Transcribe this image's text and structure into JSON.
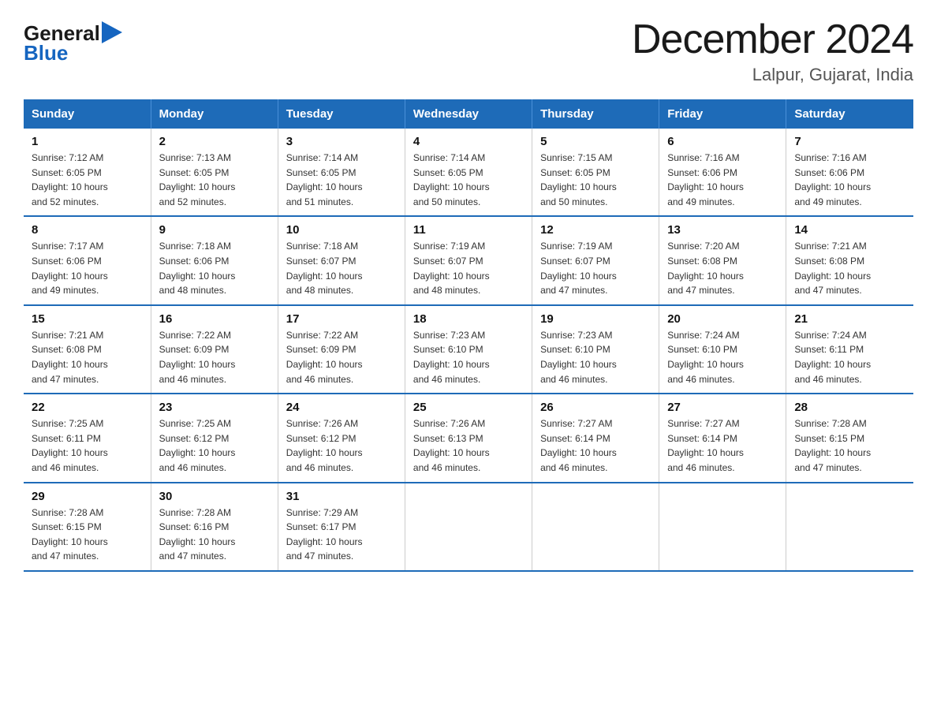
{
  "header": {
    "logo_line1": "General",
    "logo_line2": "Blue",
    "title": "December 2024",
    "subtitle": "Lalpur, Gujarat, India"
  },
  "days_of_week": [
    "Sunday",
    "Monday",
    "Tuesday",
    "Wednesday",
    "Thursday",
    "Friday",
    "Saturday"
  ],
  "weeks": [
    [
      {
        "date": "1",
        "sunrise": "7:12 AM",
        "sunset": "6:05 PM",
        "daylight": "10 hours and 52 minutes."
      },
      {
        "date": "2",
        "sunrise": "7:13 AM",
        "sunset": "6:05 PM",
        "daylight": "10 hours and 52 minutes."
      },
      {
        "date": "3",
        "sunrise": "7:14 AM",
        "sunset": "6:05 PM",
        "daylight": "10 hours and 51 minutes."
      },
      {
        "date": "4",
        "sunrise": "7:14 AM",
        "sunset": "6:05 PM",
        "daylight": "10 hours and 50 minutes."
      },
      {
        "date": "5",
        "sunrise": "7:15 AM",
        "sunset": "6:05 PM",
        "daylight": "10 hours and 50 minutes."
      },
      {
        "date": "6",
        "sunrise": "7:16 AM",
        "sunset": "6:06 PM",
        "daylight": "10 hours and 49 minutes."
      },
      {
        "date": "7",
        "sunrise": "7:16 AM",
        "sunset": "6:06 PM",
        "daylight": "10 hours and 49 minutes."
      }
    ],
    [
      {
        "date": "8",
        "sunrise": "7:17 AM",
        "sunset": "6:06 PM",
        "daylight": "10 hours and 49 minutes."
      },
      {
        "date": "9",
        "sunrise": "7:18 AM",
        "sunset": "6:06 PM",
        "daylight": "10 hours and 48 minutes."
      },
      {
        "date": "10",
        "sunrise": "7:18 AM",
        "sunset": "6:07 PM",
        "daylight": "10 hours and 48 minutes."
      },
      {
        "date": "11",
        "sunrise": "7:19 AM",
        "sunset": "6:07 PM",
        "daylight": "10 hours and 48 minutes."
      },
      {
        "date": "12",
        "sunrise": "7:19 AM",
        "sunset": "6:07 PM",
        "daylight": "10 hours and 47 minutes."
      },
      {
        "date": "13",
        "sunrise": "7:20 AM",
        "sunset": "6:08 PM",
        "daylight": "10 hours and 47 minutes."
      },
      {
        "date": "14",
        "sunrise": "7:21 AM",
        "sunset": "6:08 PM",
        "daylight": "10 hours and 47 minutes."
      }
    ],
    [
      {
        "date": "15",
        "sunrise": "7:21 AM",
        "sunset": "6:08 PM",
        "daylight": "10 hours and 47 minutes."
      },
      {
        "date": "16",
        "sunrise": "7:22 AM",
        "sunset": "6:09 PM",
        "daylight": "10 hours and 46 minutes."
      },
      {
        "date": "17",
        "sunrise": "7:22 AM",
        "sunset": "6:09 PM",
        "daylight": "10 hours and 46 minutes."
      },
      {
        "date": "18",
        "sunrise": "7:23 AM",
        "sunset": "6:10 PM",
        "daylight": "10 hours and 46 minutes."
      },
      {
        "date": "19",
        "sunrise": "7:23 AM",
        "sunset": "6:10 PM",
        "daylight": "10 hours and 46 minutes."
      },
      {
        "date": "20",
        "sunrise": "7:24 AM",
        "sunset": "6:10 PM",
        "daylight": "10 hours and 46 minutes."
      },
      {
        "date": "21",
        "sunrise": "7:24 AM",
        "sunset": "6:11 PM",
        "daylight": "10 hours and 46 minutes."
      }
    ],
    [
      {
        "date": "22",
        "sunrise": "7:25 AM",
        "sunset": "6:11 PM",
        "daylight": "10 hours and 46 minutes."
      },
      {
        "date": "23",
        "sunrise": "7:25 AM",
        "sunset": "6:12 PM",
        "daylight": "10 hours and 46 minutes."
      },
      {
        "date": "24",
        "sunrise": "7:26 AM",
        "sunset": "6:12 PM",
        "daylight": "10 hours and 46 minutes."
      },
      {
        "date": "25",
        "sunrise": "7:26 AM",
        "sunset": "6:13 PM",
        "daylight": "10 hours and 46 minutes."
      },
      {
        "date": "26",
        "sunrise": "7:27 AM",
        "sunset": "6:14 PM",
        "daylight": "10 hours and 46 minutes."
      },
      {
        "date": "27",
        "sunrise": "7:27 AM",
        "sunset": "6:14 PM",
        "daylight": "10 hours and 46 minutes."
      },
      {
        "date": "28",
        "sunrise": "7:28 AM",
        "sunset": "6:15 PM",
        "daylight": "10 hours and 47 minutes."
      }
    ],
    [
      {
        "date": "29",
        "sunrise": "7:28 AM",
        "sunset": "6:15 PM",
        "daylight": "10 hours and 47 minutes."
      },
      {
        "date": "30",
        "sunrise": "7:28 AM",
        "sunset": "6:16 PM",
        "daylight": "10 hours and 47 minutes."
      },
      {
        "date": "31",
        "sunrise": "7:29 AM",
        "sunset": "6:17 PM",
        "daylight": "10 hours and 47 minutes."
      },
      null,
      null,
      null,
      null
    ]
  ],
  "labels": {
    "sunrise_prefix": "Sunrise: ",
    "sunset_prefix": "Sunset: ",
    "daylight_prefix": "Daylight: "
  }
}
